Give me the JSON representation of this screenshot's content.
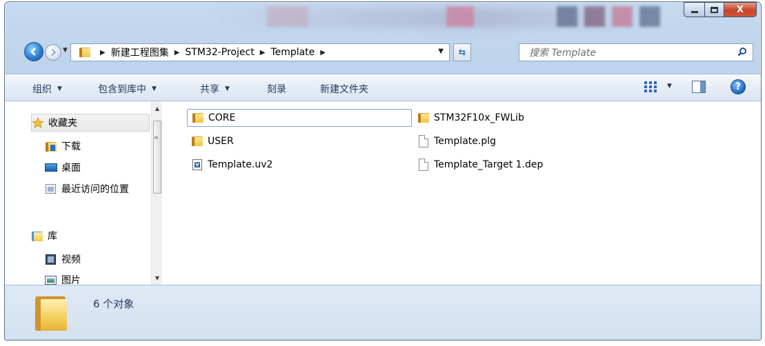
{
  "window": {
    "caption_buttons": {
      "minimize": "minimize",
      "maximize": "maximize",
      "close": "X"
    }
  },
  "address": {
    "breadcrumbs": [
      "新建工程图集",
      "STM32-Project",
      "Template"
    ],
    "search_placeholder": "搜索 Template"
  },
  "toolbar": {
    "items": [
      {
        "label": "组织",
        "dropdown": true
      },
      {
        "label": "包含到库中",
        "dropdown": true
      },
      {
        "label": "共享",
        "dropdown": true
      },
      {
        "label": "刻录",
        "dropdown": false
      },
      {
        "label": "新建文件夹",
        "dropdown": false
      }
    ]
  },
  "nav_pane": {
    "items": [
      {
        "label": "收藏夹",
        "icon": "star-icon"
      },
      {
        "label": "下载",
        "icon": "download-folder-icon"
      },
      {
        "label": "桌面",
        "icon": "desktop-icon"
      },
      {
        "label": "最近访问的位置",
        "icon": "recent-places-icon"
      },
      {
        "label": "库",
        "icon": "library-icon"
      },
      {
        "label": "视频",
        "icon": "video-icon"
      },
      {
        "label": "图片",
        "icon": "picture-icon"
      }
    ]
  },
  "files": [
    {
      "name": "CORE",
      "type": "folder"
    },
    {
      "name": "USER",
      "type": "folder"
    },
    {
      "name": "Template.uv2",
      "type": "uv2"
    },
    {
      "name": "STM32F10x_FWLib",
      "type": "folder"
    },
    {
      "name": "Template.plg",
      "type": "file"
    },
    {
      "name": "Template_Target 1.dep",
      "type": "file"
    }
  ],
  "status": {
    "count_text": "6 个对象"
  },
  "colors": {
    "accent": "#1e395b",
    "window_frame": "#b4cde8",
    "folder": "#f0c24c"
  }
}
